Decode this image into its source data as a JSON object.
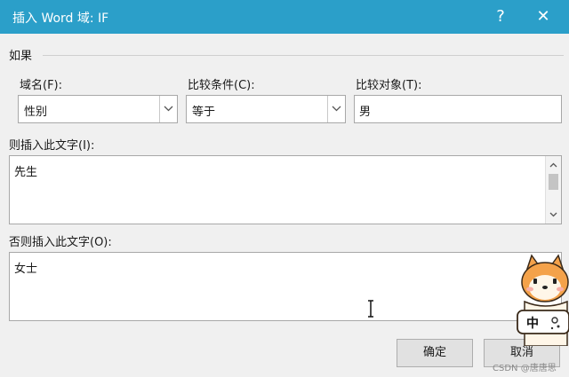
{
  "window": {
    "title": "插入 Word 域: IF",
    "help_label": "?",
    "close_label": "✕"
  },
  "group": {
    "label": "如果"
  },
  "field_name": {
    "label": "域名(F):",
    "value": "性别"
  },
  "comparison": {
    "label": "比较条件(C):",
    "value": "等于"
  },
  "compare_to": {
    "label": "比较对象(T):",
    "value": "男"
  },
  "insert_text": {
    "label": "则插入此文字(I):",
    "value": "先生"
  },
  "otherwise_text": {
    "label": "否则插入此文字(O):",
    "value": "女士"
  },
  "buttons": {
    "ok": "确定",
    "cancel": "取消"
  },
  "overlay": {
    "mascot_sign": "中",
    "watermark": "CSDN @唐唐思"
  },
  "icons": {
    "dropdown": "chevron-down-icon",
    "scroll_up": "scroll-up-icon",
    "scroll_down": "scroll-down-icon",
    "cursor": "text-cursor-icon",
    "mascot": "shiba-mascot-icon"
  },
  "colors": {
    "titlebar": "#2b9fc9",
    "dialog_bg": "#f0f0f0",
    "field_bg": "#ffffff"
  }
}
